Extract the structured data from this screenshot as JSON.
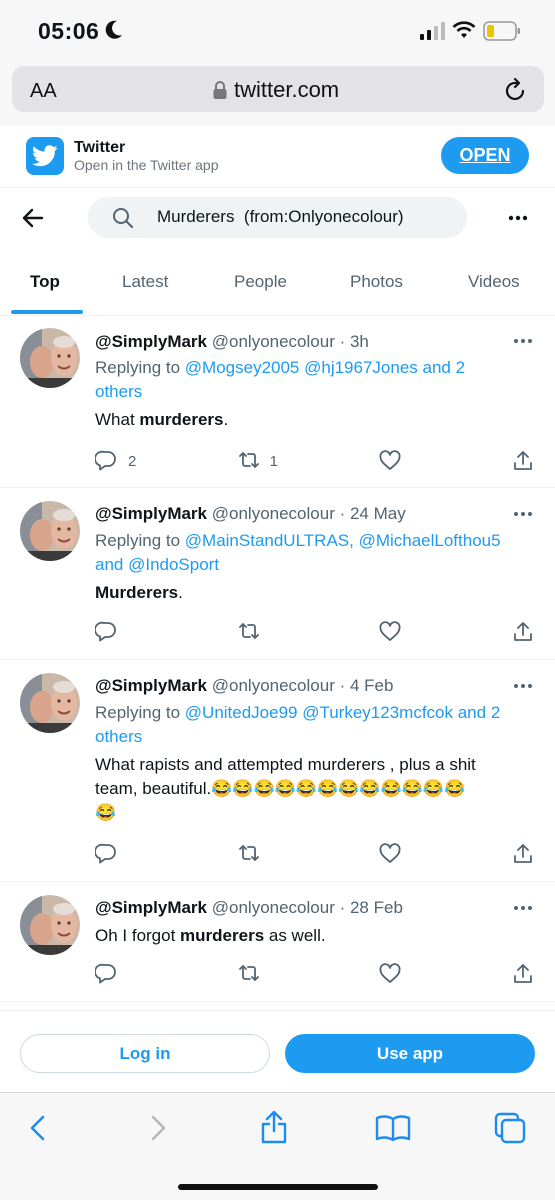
{
  "status_bar": {
    "time": "05:06"
  },
  "browser": {
    "text_size_label": "AA",
    "domain": "twitter.com"
  },
  "app_banner": {
    "title": "Twitter",
    "subtitle": "Open in the Twitter app",
    "open_label": "OPEN"
  },
  "search": {
    "query": "Murderers  (from:Onlyonecolour)"
  },
  "tabs": [
    {
      "label": "Top",
      "active": true
    },
    {
      "label": "Latest"
    },
    {
      "label": "People"
    },
    {
      "label": "Photos"
    },
    {
      "label": "Videos"
    }
  ],
  "tweets": [
    {
      "name": "@SimplyMark",
      "handle_time": "@onlyonecolour · 3h",
      "reply_prefix": "Replying to ",
      "reply_line1": "@Mogsey2005 @hj1967Jones  and 2",
      "reply_line2": "others",
      "text_before": "What ",
      "text_bold": "murderers",
      "text_after": ".",
      "replies": "2",
      "retweets": "1"
    },
    {
      "name": "@SimplyMark",
      "handle_time": "@onlyonecolour · 24 May",
      "reply_prefix": "Replying to ",
      "reply_line1": "@MainStandULTRAS, @MichaelLofthou5",
      "reply_line2": "and @IndoSport",
      "text_bold": "Murderers",
      "text_after": "."
    },
    {
      "name": "@SimplyMark",
      "handle_time": "@onlyonecolour · 4 Feb",
      "reply_prefix": "Replying to ",
      "reply_line1": "@UnitedJoe99 @Turkey123mcfcok  and 2",
      "reply_line2": "others",
      "text_line1": "What rapists and attempted murderers , plus a shit",
      "text_line2": "team, beautiful.😂😂😂😂😂😂😂😂😂😂😂😂",
      "text_line3": "😂"
    },
    {
      "name": "@SimplyMark",
      "handle_time": "@onlyonecolour · 28 Feb",
      "text_before": "Oh I forgot ",
      "text_bold": "murderers",
      "text_after": " as well."
    }
  ],
  "bottom": {
    "login_label": "Log in",
    "use_app_label": "Use app"
  },
  "colors": {
    "accent": "#1d9bf0",
    "text": "#0f1419",
    "secondary": "#536471"
  }
}
